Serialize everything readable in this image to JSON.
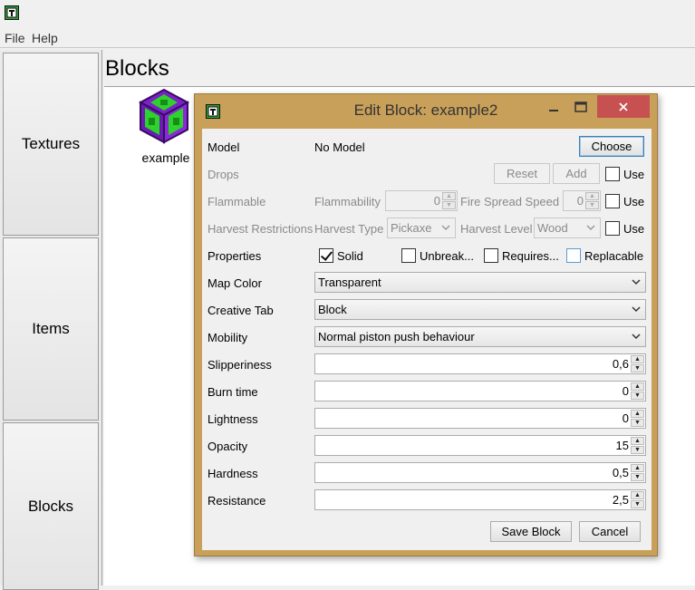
{
  "menu": {
    "file": "File",
    "help": "Help"
  },
  "sidebar": {
    "items": [
      {
        "label": "Textures"
      },
      {
        "label": "Items"
      },
      {
        "label": "Blocks"
      }
    ]
  },
  "main": {
    "title": "Blocks",
    "blocks": [
      {
        "label": "example"
      }
    ]
  },
  "dialog": {
    "title": "Edit Block: example2",
    "model": {
      "label": "Model",
      "value": "No Model",
      "choose": "Choose"
    },
    "drops": {
      "label": "Drops",
      "reset": "Reset",
      "add": "Add",
      "use": "Use"
    },
    "flammable": {
      "label": "Flammable",
      "flammability_label": "Flammability",
      "flammability": "0",
      "fire_spread_label": "Fire Spread Speed",
      "fire_spread": "0",
      "use": "Use"
    },
    "harvest": {
      "label": "Harvest Restrictions",
      "type_label": "Harvest Type",
      "type": "Pickaxe",
      "level_label": "Harvest Level",
      "level": "Wood",
      "use": "Use"
    },
    "properties": {
      "label": "Properties",
      "solid": "Solid",
      "unbreakable": "Unbreak...",
      "requires": "Requires...",
      "replacable": "Replacable"
    },
    "fields": {
      "map_color": {
        "label": "Map Color",
        "value": "Transparent"
      },
      "creative_tab": {
        "label": "Creative Tab",
        "value": "Block"
      },
      "mobility": {
        "label": "Mobility",
        "value": "Normal piston push behaviour"
      },
      "slipperiness": {
        "label": "Slipperiness",
        "value": "0,6"
      },
      "burn_time": {
        "label": "Burn time",
        "value": "0"
      },
      "lightness": {
        "label": "Lightness",
        "value": "0"
      },
      "opacity": {
        "label": "Opacity",
        "value": "15"
      },
      "hardness": {
        "label": "Hardness",
        "value": "0,5"
      },
      "resistance": {
        "label": "Resistance",
        "value": "2,5"
      }
    },
    "save": "Save Block",
    "cancel": "Cancel"
  },
  "colors": {
    "dialog_frame": "#c9a05a",
    "close_button": "#c75050",
    "block_purple": "#7a22c4",
    "block_green": "#2bd32b"
  }
}
